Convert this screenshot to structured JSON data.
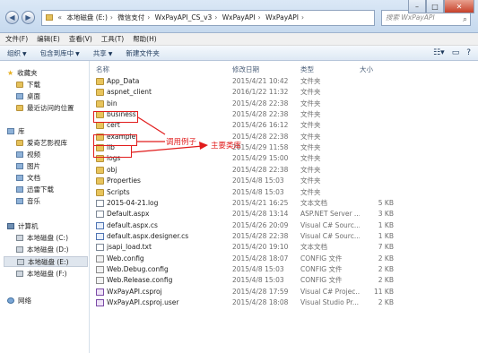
{
  "window": {
    "breadcrumb": [
      "本地磁盘 (E:)",
      "微信支付",
      "WxPayAPI_CS_v3",
      "WxPayAPI",
      "WxPayAPI"
    ],
    "search_placeholder": "搜索 WxPayAPI"
  },
  "menu": [
    "文件(F)",
    "编辑(E)",
    "查看(V)",
    "工具(T)",
    "帮助(H)"
  ],
  "toolbar": {
    "organize": "组织",
    "include_library": "包含到库中",
    "share": "共享",
    "new_folder": "新建文件夹"
  },
  "nav": {
    "favorites": {
      "label": "收藏夹",
      "items": [
        "下载",
        "桌面",
        "最近访问的位置"
      ]
    },
    "libraries": {
      "label": "库",
      "items": [
        "爱奇艺影视库",
        "视频",
        "图片",
        "文档",
        "迅雷下载",
        "音乐"
      ]
    },
    "computer": {
      "label": "计算机",
      "items": [
        "本地磁盘 (C:)",
        "本地磁盘 (D:)",
        "本地磁盘 (E:)",
        "本地磁盘 (F:)"
      ]
    },
    "network": {
      "label": "网络"
    }
  },
  "columns": {
    "name": "名称",
    "date": "修改日期",
    "type": "类型",
    "size": "大小"
  },
  "files": [
    {
      "name": "App_Data",
      "date": "2015/4/21 10:42",
      "type": "文件夹",
      "size": "",
      "kind": "folder"
    },
    {
      "name": "aspnet_client",
      "date": "2016/1/22 11:32",
      "type": "文件夹",
      "size": "",
      "kind": "folder"
    },
    {
      "name": "bin",
      "date": "2015/4/28 22:38",
      "type": "文件夹",
      "size": "",
      "kind": "folder"
    },
    {
      "name": "business",
      "date": "2015/4/28 22:38",
      "type": "文件夹",
      "size": "",
      "kind": "folder"
    },
    {
      "name": "cert",
      "date": "2015/4/26 16:12",
      "type": "文件夹",
      "size": "",
      "kind": "folder"
    },
    {
      "name": "example",
      "date": "2015/4/28 22:38",
      "type": "文件夹",
      "size": "",
      "kind": "folder"
    },
    {
      "name": "lib",
      "date": "2015/4/29 11:58",
      "type": "文件夹",
      "size": "",
      "kind": "folder"
    },
    {
      "name": "logs",
      "date": "2015/4/29 15:00",
      "type": "文件夹",
      "size": "",
      "kind": "folder"
    },
    {
      "name": "obj",
      "date": "2015/4/28 22:38",
      "type": "文件夹",
      "size": "",
      "kind": "folder"
    },
    {
      "name": "Properties",
      "date": "2015/4/8 15:03",
      "type": "文件夹",
      "size": "",
      "kind": "folder"
    },
    {
      "name": "Scripts",
      "date": "2015/4/8 15:03",
      "type": "文件夹",
      "size": "",
      "kind": "folder"
    },
    {
      "name": "2015-04-21.log",
      "date": "2015/4/21 16:25",
      "type": "文本文档",
      "size": "5 KB",
      "kind": "file"
    },
    {
      "name": "Default.aspx",
      "date": "2015/4/28 13:14",
      "type": "ASP.NET Server ...",
      "size": "3 KB",
      "kind": "file"
    },
    {
      "name": "default.aspx.cs",
      "date": "2015/4/26 20:09",
      "type": "Visual C# Sourc...",
      "size": "1 KB",
      "kind": "cs"
    },
    {
      "name": "default.aspx.designer.cs",
      "date": "2015/4/28 22:38",
      "type": "Visual C# Sourc...",
      "size": "1 KB",
      "kind": "cs"
    },
    {
      "name": "jsapi_load.txt",
      "date": "2015/4/20 19:10",
      "type": "文本文档",
      "size": "7 KB",
      "kind": "file"
    },
    {
      "name": "Web.config",
      "date": "2015/4/28 18:07",
      "type": "CONFIG 文件",
      "size": "2 KB",
      "kind": "cfg"
    },
    {
      "name": "Web.Debug.config",
      "date": "2015/4/8 15:03",
      "type": "CONFIG 文件",
      "size": "2 KB",
      "kind": "cfg"
    },
    {
      "name": "Web.Release.config",
      "date": "2015/4/8 15:03",
      "type": "CONFIG 文件",
      "size": "2 KB",
      "kind": "cfg"
    },
    {
      "name": "WxPayAPI.csproj",
      "date": "2015/4/28 17:59",
      "type": "Visual C# Projec...",
      "size": "11 KB",
      "kind": "proj"
    },
    {
      "name": "WxPayAPI.csproj.user",
      "date": "2015/4/28 18:08",
      "type": "Visual Studio Pr...",
      "size": "2 KB",
      "kind": "proj"
    }
  ],
  "annotations": {
    "call_examples": "调用例子",
    "main_library": "主要类库"
  },
  "colors": {
    "annotation": "#e11c1c"
  }
}
